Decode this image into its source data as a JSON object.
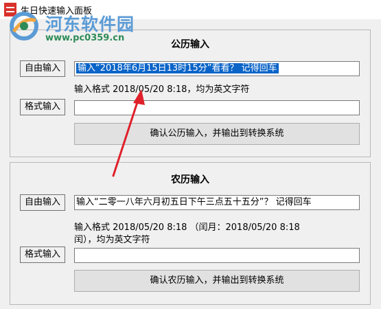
{
  "window": {
    "title": "生日快速输入面板"
  },
  "watermark": {
    "brand": "河东软件园",
    "url": "www.pc0359.cn"
  },
  "solar": {
    "title": "公历输入",
    "free_label": "自由输入",
    "free_value": "输入“2018年6月15日13时15分”看看？ 记得回车",
    "format_hint": "输入格式 2018/05/20 8:18，均为英文字符",
    "format_label": "格式输入",
    "format_value": "",
    "confirm_label": "确认公历输入，并输出到转换系统"
  },
  "lunar": {
    "title": "农历输入",
    "free_label": "自由输入",
    "free_value": "输入“二零一八年六月初五日下午三点五十五分”？ 记得回车",
    "format_hint_line1": "输入格式 2018/05/20 8:18  （闰月：2018/05/20 8:18",
    "format_hint_line2": "闰），均为英文字符",
    "format_label": "格式输入",
    "format_value": "",
    "confirm_label": "确认农历输入，并输出到转换系统"
  },
  "colors": {
    "selection": "#0a64c8",
    "annotation_arrow": "#e0202a",
    "watermark_blue": "#5b9bd5",
    "watermark_green": "#2e8b57"
  }
}
